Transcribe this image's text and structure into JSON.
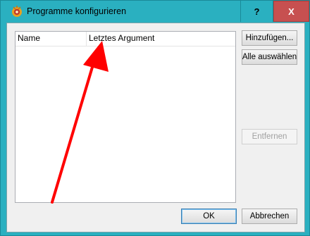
{
  "window": {
    "title": "Programme konfigurieren",
    "help_label": "?",
    "close_label": "X"
  },
  "list": {
    "columns": [
      {
        "label": "Name"
      },
      {
        "label": "Letztes Argument"
      }
    ]
  },
  "buttons": {
    "add": "Hinzufügen...",
    "select_all": "Alle auswählen",
    "remove": "Entfernen",
    "ok": "OK",
    "cancel": "Abbrechen"
  },
  "colors": {
    "accent": "#2ab0c0",
    "close": "#c75050",
    "annotation": "#ff0000"
  }
}
